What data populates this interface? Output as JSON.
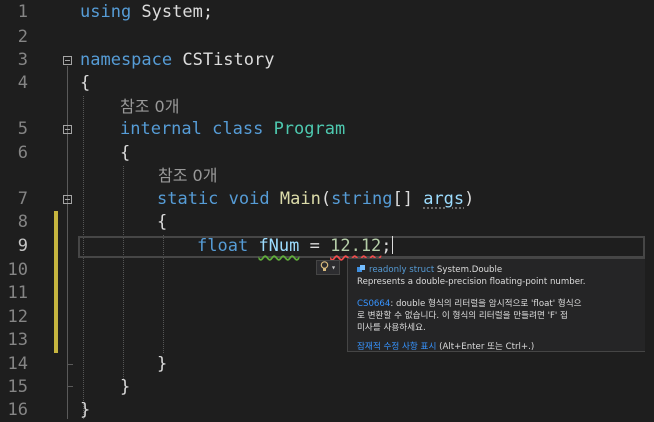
{
  "editor": {
    "line_numbers": [
      "1",
      "2",
      "3",
      "4",
      "5",
      "6",
      "7",
      "8",
      "9",
      "10",
      "11",
      "12",
      "13",
      "14",
      "15",
      "16"
    ],
    "lines": {
      "l1_using": "using",
      "l1_system": " System;",
      "l3_namespace": "namespace",
      "l3_name": " CSTistory",
      "l4_brace": "{",
      "l5_internal": "internal",
      "l5_class": " class",
      "l5_space": " ",
      "l5_program": "Program",
      "l6_brace": "{",
      "l7_static": "static",
      "l7_void": " void",
      "l7_space": " ",
      "l7_main": "Main",
      "l7_paren": "(",
      "l7_string": "string",
      "l7_brackets": "[] ",
      "l7_args": "args",
      "l7_close": ")",
      "l8_brace": "{",
      "l9_float": "float",
      "l9_space": " ",
      "l9_fnum": "fNum",
      "l9_eq": " = ",
      "l9_num": "12.12",
      "l9_semi": ";",
      "l14_brace": "}",
      "l15_brace": "}",
      "l16_brace": "}"
    },
    "codelens": {
      "class_refs": "참조 0개",
      "method_refs": "참조 0개"
    }
  },
  "quick_info": {
    "modifier": "readonly struct",
    "type_name": "System.Double",
    "description": "Represents a double-precision floating-point number.",
    "error_code": "CS0664",
    "error_text_1": ": double 형식의 리터럴을 암시적으로 'float' 형식으",
    "error_text_2": "로 변환할 수 없습니다. 이 형식의 리터럴을 만들려면 'F' 접",
    "error_text_3": "미사를 사용하세요.",
    "fix_link": "잠재적 수정 사항 표시",
    "fix_shortcut": " (Alt+Enter 또는 Ctrl+.)"
  },
  "colors": {
    "background": "#1e1e1e",
    "keyword": "#569cd6",
    "type": "#4ec9b0",
    "method": "#dcdcaa",
    "variable": "#9cdcfe",
    "number": "#b5cea8",
    "link": "#3794ff"
  },
  "icons": {
    "lightbulb": "lightbulb-icon",
    "struct": "struct-icon"
  }
}
